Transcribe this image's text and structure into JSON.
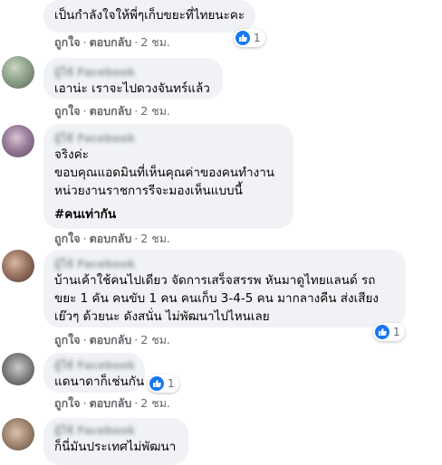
{
  "ui": {
    "like_label": "ถูกใจ",
    "reply_label": "ตอบกลับ",
    "separator": "·"
  },
  "comments": [
    {
      "lines": [
        "เป็นกำลังใจให้พี่ๆเก็บขยะที่ไทยนะคะ"
      ],
      "time": "2 ชม.",
      "reaction_count": "1",
      "avatar_icon": "hidden-avatar"
    },
    {
      "author": "ผู้ใช้ Facebook",
      "lines": [
        "เอาน่ะ เราจะไปดวงจันทร์แล้ว"
      ],
      "time": "2 ชม.",
      "avatar_icon": "user-avatar-photo"
    },
    {
      "author": "ผู้ใช้ Facebook",
      "lines": [
        "จริงค่ะ",
        "ขอบคุณแอดมินที่เห็นคุณค่าของคนทำงาน",
        "หน่วยงานราชการรีจะมองเห็นแบบนี้"
      ],
      "hashtag": "#คนเท่ากัน",
      "time": "2 ชม.",
      "avatar_icon": "user-avatar-photo"
    },
    {
      "author": "ผู้ใช้ Facebook",
      "lines": [
        "บ้านเค้าใช้คนไปเดียว จัดการเสร็จสรรพ หันมาดูไทยแลนด์ รถ",
        "ขยะ 1 คัน คนขับ 1 คน คนเก็บ 3-4-5 คน มากลางคืน ส่งเสียง",
        "เย๊วๆ ด้วยนะ ดังสนั่น ไม่พัฒนาไปไหนเลย"
      ],
      "time": "2 ชม.",
      "reaction_count": "1",
      "avatar_icon": "user-avatar-photo"
    },
    {
      "author": "ผู้ใช้ Facebook",
      "lines": [
        "แดนาดาก็เช่นกัน"
      ],
      "time": "2 ชม.",
      "reaction_count": "1",
      "avatar_icon": "user-avatar-photo"
    },
    {
      "author": "ผู้ใช้ Facebook",
      "lines": [
        "ก็นี่มันประเทศไม่พัฒนา"
      ],
      "avatar_icon": "user-avatar-photo"
    }
  ],
  "colors": {
    "bubble": "#f0f2f5",
    "meta_text": "#65676b",
    "like_blue": "#1877f2"
  }
}
